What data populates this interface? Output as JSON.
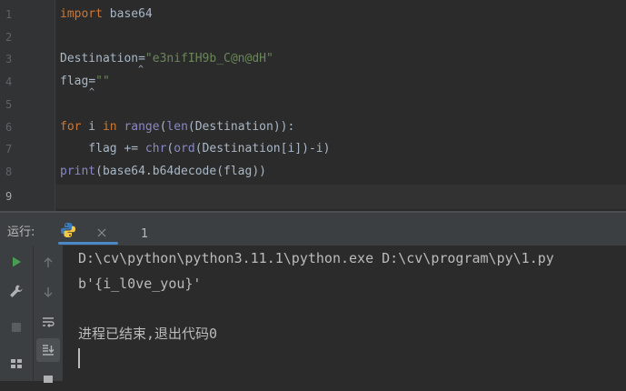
{
  "editor": {
    "line_numbers": [
      "1",
      "2",
      "3",
      "4",
      "5",
      "6",
      "7",
      "8",
      "9"
    ],
    "lines": [
      [
        {
          "t": "import",
          "c": "kw"
        },
        {
          "t": " base64",
          "c": ""
        }
      ],
      [],
      [
        {
          "t": "Destination",
          "c": ""
        },
        {
          "t": "=",
          "c": ""
        },
        {
          "t": "\"e3nifIH9b_C@n@dH\"",
          "c": "str"
        }
      ],
      [
        {
          "t": "flag",
          "c": ""
        },
        {
          "t": "=",
          "c": ""
        },
        {
          "t": "\"\"",
          "c": "str"
        }
      ],
      [],
      [
        {
          "t": "for",
          "c": "kw"
        },
        {
          "t": " i ",
          "c": ""
        },
        {
          "t": "in",
          "c": "kw"
        },
        {
          "t": " ",
          "c": ""
        },
        {
          "t": "range",
          "c": "bi"
        },
        {
          "t": "(",
          "c": ""
        },
        {
          "t": "len",
          "c": "bi"
        },
        {
          "t": "(Destination)):",
          "c": ""
        }
      ],
      [
        {
          "t": "    flag += ",
          "c": ""
        },
        {
          "t": "chr",
          "c": "bi"
        },
        {
          "t": "(",
          "c": ""
        },
        {
          "t": "ord",
          "c": "bi"
        },
        {
          "t": "(Destination[i])-i)",
          "c": ""
        }
      ],
      [
        {
          "t": "print",
          "c": "bi"
        },
        {
          "t": "(base64.b64decode(flag))",
          "c": ""
        }
      ],
      []
    ]
  },
  "run_panel": {
    "label": "运行:",
    "tab_number": "1",
    "output": [
      "D:\\cv\\python\\python3.11.1\\python.exe D:\\cv\\program\\py\\1.py",
      "b'{i_l0ve_you}'",
      "",
      "进程已结束,退出代码0"
    ]
  },
  "colors": {
    "keyword": "#cc7832",
    "string": "#6a8759",
    "builtin": "#8888c6",
    "accent": "#4a88c7",
    "run_green": "#499c54"
  }
}
